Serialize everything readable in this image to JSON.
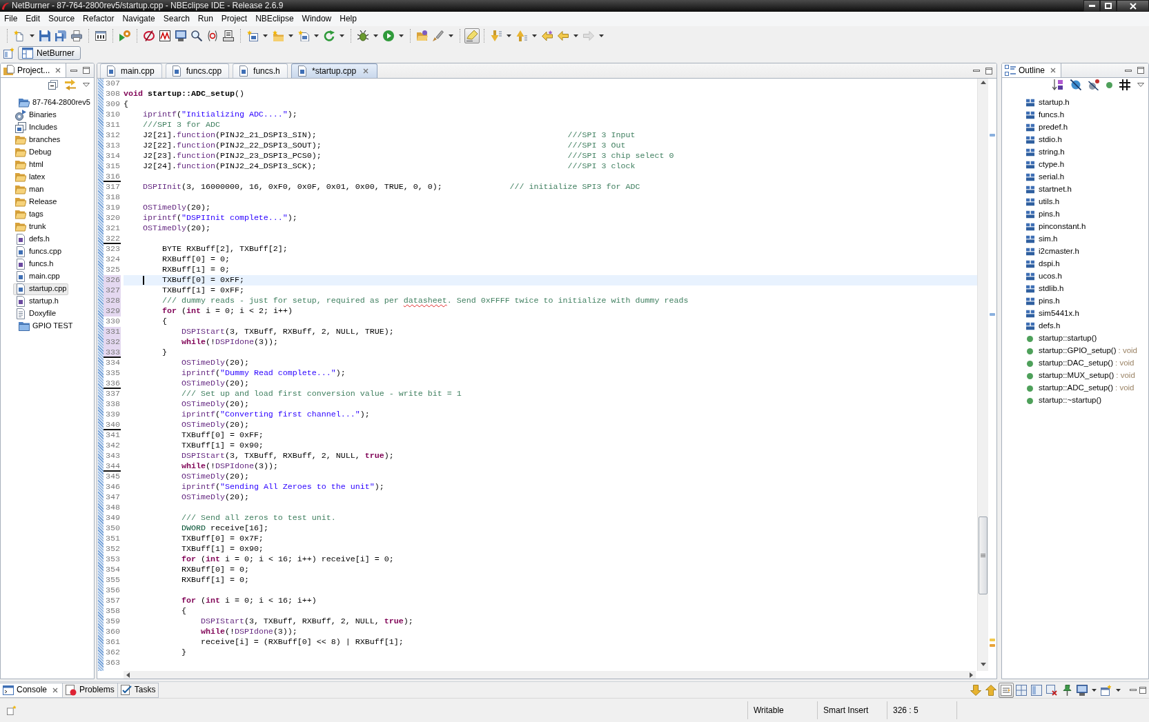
{
  "window": {
    "title": "NetBurner - 87-764-2800rev5/startup.cpp - NBEclipse IDE - Release 2.6.9"
  },
  "menu": [
    "File",
    "Edit",
    "Source",
    "Refactor",
    "Navigate",
    "Search",
    "Run",
    "Project",
    "NBEclipse",
    "Window",
    "Help"
  ],
  "toolbar": [
    {
      "items": [
        {
          "kind": "new",
          "dropdown": true,
          "pressed": false,
          "disabled": false
        },
        {
          "kind": "save",
          "dropdown": false,
          "pressed": false,
          "disabled": false
        },
        {
          "kind": "save_all",
          "dropdown": false,
          "pressed": false,
          "disabled": false
        },
        {
          "kind": "print",
          "dropdown": false,
          "pressed": false,
          "disabled": false
        }
      ]
    },
    {
      "items": [
        {
          "kind": "binary",
          "dropdown": false,
          "pressed": false,
          "disabled": false
        }
      ]
    },
    {
      "items": [
        {
          "kind": "run_gear",
          "dropdown": false,
          "pressed": false,
          "disabled": false
        }
      ]
    },
    {
      "items": [
        {
          "kind": "ring_slash",
          "dropdown": false,
          "pressed": false,
          "disabled": false
        },
        {
          "kind": "zigzag",
          "dropdown": false,
          "pressed": false,
          "disabled": false
        },
        {
          "kind": "monitor",
          "dropdown": false,
          "pressed": false,
          "disabled": false
        },
        {
          "kind": "search",
          "dropdown": false,
          "pressed": false,
          "disabled": false
        },
        {
          "kind": "circle",
          "dropdown": false,
          "pressed": false,
          "disabled": false
        },
        {
          "kind": "stack",
          "dropdown": false,
          "pressed": false,
          "disabled": false
        }
      ]
    },
    {
      "items": [
        {
          "kind": "new_class",
          "dropdown": true,
          "pressed": false,
          "disabled": false
        },
        {
          "kind": "new_folder",
          "dropdown": true,
          "pressed": false,
          "disabled": false
        },
        {
          "kind": "new_source",
          "dropdown": true,
          "pressed": false,
          "disabled": false
        },
        {
          "kind": "refresh_green",
          "dropdown": true,
          "pressed": false,
          "disabled": false
        }
      ]
    },
    {
      "items": [
        {
          "kind": "debug",
          "dropdown": true,
          "pressed": false,
          "disabled": false
        },
        {
          "kind": "run",
          "dropdown": true,
          "pressed": false,
          "disabled": false
        }
      ]
    },
    {
      "items": [
        {
          "kind": "open_folder",
          "dropdown": false,
          "pressed": false,
          "disabled": false
        },
        {
          "kind": "brush",
          "dropdown": true,
          "pressed": false,
          "disabled": false
        }
      ]
    },
    {
      "items": [
        {
          "kind": "highlight",
          "dropdown": false,
          "pressed": true,
          "disabled": false
        }
      ]
    },
    {
      "items": [
        {
          "kind": "next_annotation",
          "dropdown": true,
          "pressed": false,
          "disabled": false
        },
        {
          "kind": "prev_annotation",
          "dropdown": true,
          "pressed": false,
          "disabled": false
        },
        {
          "kind": "last_edit",
          "dropdown": false,
          "pressed": false,
          "disabled": false
        },
        {
          "kind": "back",
          "dropdown": true,
          "pressed": false,
          "disabled": false
        },
        {
          "kind": "forward",
          "dropdown": true,
          "pressed": false,
          "disabled": true
        }
      ]
    }
  ],
  "perspectives": [
    {
      "label": "NetBurner",
      "selected": true
    }
  ],
  "project_explorer": {
    "tab": {
      "label": "Project...",
      "selected": true
    },
    "items": [
      {
        "label": "87-764-2800rev5",
        "kind": "project",
        "expanded": true,
        "selected": false,
        "children": [
          {
            "label": "Binaries",
            "kind": "binaries",
            "selected": false
          },
          {
            "label": "Includes",
            "kind": "includes",
            "selected": false
          },
          {
            "label": "branches",
            "kind": "folder",
            "selected": false
          },
          {
            "label": "Debug",
            "kind": "folder",
            "selected": false
          },
          {
            "label": "html",
            "kind": "folder",
            "selected": false
          },
          {
            "label": "latex",
            "kind": "folder",
            "selected": false
          },
          {
            "label": "man",
            "kind": "folder",
            "selected": false
          },
          {
            "label": "Release",
            "kind": "folder",
            "selected": false
          },
          {
            "label": "tags",
            "kind": "folder",
            "selected": false
          },
          {
            "label": "trunk",
            "kind": "folder",
            "selected": false
          },
          {
            "label": "defs.h",
            "kind": "header",
            "selected": false
          },
          {
            "label": "funcs.cpp",
            "kind": "source",
            "selected": false
          },
          {
            "label": "funcs.h",
            "kind": "header",
            "selected": false
          },
          {
            "label": "main.cpp",
            "kind": "source",
            "selected": false
          },
          {
            "label": "startup.cpp",
            "kind": "source",
            "selected": true
          },
          {
            "label": "startup.h",
            "kind": "header",
            "selected": false
          },
          {
            "label": "Doxyfile",
            "kind": "text",
            "selected": false
          }
        ]
      },
      {
        "label": "GPIO TEST",
        "kind": "project",
        "expanded": false,
        "selected": false
      }
    ]
  },
  "editor": {
    "tabs": [
      {
        "label": "main.cpp",
        "selected": false
      },
      {
        "label": "funcs.cpp",
        "selected": false
      },
      {
        "label": "funcs.h",
        "selected": false
      },
      {
        "label": "*startup.cpp",
        "selected": true
      }
    ],
    "lines": [
      {
        "number": "307",
        "current": false,
        "changed": false,
        "deleted": false
      },
      {
        "number": "308",
        "current": false,
        "changed": false,
        "deleted": false,
        "tokens": [
          {
            "kind": "keyword",
            "text": "void"
          },
          {
            "kind": "declaration",
            "text": " startup::ADC_setup"
          },
          {
            "kind": "plain",
            "text": "()"
          }
        ]
      },
      {
        "number": "309",
        "current": false,
        "changed": false,
        "deleted": false,
        "tokens": [
          {
            "kind": "plain",
            "text": "{"
          }
        ]
      },
      {
        "number": "310",
        "current": false,
        "changed": false,
        "deleted": false,
        "tokens": [
          {
            "kind": "function",
            "text": "    iprintf"
          },
          {
            "kind": "plain",
            "text": "("
          },
          {
            "kind": "string",
            "text": "\"Initializing ADC....\""
          },
          {
            "kind": "plain",
            "text": ");"
          }
        ]
      },
      {
        "number": "311",
        "current": false,
        "changed": false,
        "deleted": false,
        "tokens": [
          {
            "kind": "comment",
            "text": "    ///SPI 3 for ADC"
          }
        ]
      },
      {
        "number": "312",
        "current": false,
        "changed": false,
        "deleted": false,
        "tokens": [
          {
            "kind": "plain",
            "text": "    J2[21]."
          },
          {
            "kind": "function",
            "text": "function"
          },
          {
            "kind": "plain",
            "text": "(PINJ2_21_DSPI3_SIN);                                                    "
          },
          {
            "kind": "comment",
            "text": "///SPI 3 Input"
          }
        ]
      },
      {
        "number": "313",
        "current": false,
        "changed": false,
        "deleted": false,
        "tokens": [
          {
            "kind": "plain",
            "text": "    J2[22]."
          },
          {
            "kind": "function",
            "text": "function"
          },
          {
            "kind": "plain",
            "text": "(PINJ2_22_DSPI3_SOUT);                                                   "
          },
          {
            "kind": "comment",
            "text": "///SPI 3 Out"
          }
        ]
      },
      {
        "number": "314",
        "current": false,
        "changed": false,
        "deleted": false,
        "tokens": [
          {
            "kind": "plain",
            "text": "    J2[23]."
          },
          {
            "kind": "function",
            "text": "function"
          },
          {
            "kind": "plain",
            "text": "(PINJ2_23_DSPI3_PCS0);                                                   "
          },
          {
            "kind": "comment",
            "text": "///SPI 3 chip select 0"
          }
        ]
      },
      {
        "number": "315",
        "current": false,
        "changed": false,
        "deleted": false,
        "tokens": [
          {
            "kind": "plain",
            "text": "    J2[24]."
          },
          {
            "kind": "function",
            "text": "function"
          },
          {
            "kind": "plain",
            "text": "(PINJ2_24_DSPI3_SCK);                                                    "
          },
          {
            "kind": "comment",
            "text": "///SPI 3 clock"
          }
        ]
      },
      {
        "number": "316",
        "current": false,
        "changed": false,
        "deleted": true
      },
      {
        "number": "317",
        "current": false,
        "changed": false,
        "deleted": false,
        "tokens": [
          {
            "kind": "function",
            "text": "    DSPIInit"
          },
          {
            "kind": "plain",
            "text": "(3, 16000000, 16, 0xF0, 0x0F, 0x01, 0x00, TRUE, 0, 0);              "
          },
          {
            "kind": "comment",
            "text": "/// initialize SPI3 for ADC"
          }
        ]
      },
      {
        "number": "318",
        "current": false,
        "changed": false,
        "deleted": false
      },
      {
        "number": "319",
        "current": false,
        "changed": false,
        "deleted": false,
        "tokens": [
          {
            "kind": "function",
            "text": "    OSTimeDly"
          },
          {
            "kind": "plain",
            "text": "(20);"
          }
        ]
      },
      {
        "number": "320",
        "current": false,
        "changed": false,
        "deleted": false,
        "tokens": [
          {
            "kind": "function",
            "text": "    iprintf"
          },
          {
            "kind": "plain",
            "text": "("
          },
          {
            "kind": "string",
            "text": "\"DSPIInit complete...\""
          },
          {
            "kind": "plain",
            "text": ");"
          }
        ]
      },
      {
        "number": "321",
        "current": false,
        "changed": false,
        "deleted": false,
        "tokens": [
          {
            "kind": "function",
            "text": "    OSTimeDly"
          },
          {
            "kind": "plain",
            "text": "(20);"
          }
        ]
      },
      {
        "number": "322",
        "current": false,
        "changed": false,
        "deleted": true
      },
      {
        "number": "323",
        "current": false,
        "changed": false,
        "deleted": false,
        "tokens": [
          {
            "kind": "plain",
            "text": "        BYTE RXBuff[2], TXBuff[2];"
          }
        ]
      },
      {
        "number": "324",
        "current": false,
        "changed": false,
        "deleted": false,
        "tokens": [
          {
            "kind": "plain",
            "text": "        RXBuff[0] = 0;"
          }
        ]
      },
      {
        "number": "325",
        "current": false,
        "changed": false,
        "deleted": false,
        "tokens": [
          {
            "kind": "plain",
            "text": "        RXBuff[1] = 0;"
          }
        ]
      },
      {
        "number": "326",
        "current": true,
        "changed": true,
        "deleted": false,
        "tokens": [
          {
            "kind": "plain",
            "text": "        TXBuff[0] = 0xFF;"
          }
        ]
      },
      {
        "number": "327",
        "current": false,
        "changed": true,
        "deleted": false,
        "tokens": [
          {
            "kind": "plain",
            "text": "        TXBuff[1] = 0xFF;"
          }
        ]
      },
      {
        "number": "328",
        "current": false,
        "changed": true,
        "deleted": false,
        "tokens": [
          {
            "kind": "comment",
            "text": "        /// dummy reads - just for setup, required as per "
          },
          {
            "kind": "misspelled",
            "text": "datasheet"
          },
          {
            "kind": "comment",
            "text": ". Send 0xFFFF twice to initialize with dummy reads"
          }
        ]
      },
      {
        "number": "329",
        "current": false,
        "changed": true,
        "deleted": false,
        "tokens": [
          {
            "kind": "keyword",
            "text": "        for"
          },
          {
            "kind": "plain",
            "text": " ("
          },
          {
            "kind": "keyword",
            "text": "int"
          },
          {
            "kind": "plain",
            "text": " i = 0; i < 2; i++)"
          }
        ]
      },
      {
        "number": "330",
        "current": false,
        "changed": false,
        "deleted": false,
        "tokens": [
          {
            "kind": "plain",
            "text": "        {"
          }
        ]
      },
      {
        "number": "331",
        "current": false,
        "changed": true,
        "deleted": false,
        "tokens": [
          {
            "kind": "function",
            "text": "            DSPIStart"
          },
          {
            "kind": "plain",
            "text": "(3, TXBuff, RXBuff, 2, NULL, TRUE);"
          }
        ]
      },
      {
        "number": "332",
        "current": false,
        "changed": true,
        "deleted": false,
        "tokens": [
          {
            "kind": "keyword",
            "text": "            while"
          },
          {
            "kind": "plain",
            "text": "(!"
          },
          {
            "kind": "function",
            "text": "DSPIdone"
          },
          {
            "kind": "plain",
            "text": "(3));"
          }
        ]
      },
      {
        "number": "333",
        "current": false,
        "changed": true,
        "deleted": true,
        "tokens": [
          {
            "kind": "plain",
            "text": "        }"
          }
        ]
      },
      {
        "number": "334",
        "current": false,
        "changed": false,
        "deleted": false,
        "tokens": [
          {
            "kind": "function",
            "text": "            OSTimeDly"
          },
          {
            "kind": "plain",
            "text": "(20);"
          }
        ]
      },
      {
        "number": "335",
        "current": false,
        "changed": false,
        "deleted": false,
        "tokens": [
          {
            "kind": "function",
            "text": "            iprintf"
          },
          {
            "kind": "plain",
            "text": "("
          },
          {
            "kind": "string",
            "text": "\"Dummy Read complete...\""
          },
          {
            "kind": "plain",
            "text": ");"
          }
        ]
      },
      {
        "number": "336",
        "current": false,
        "changed": false,
        "deleted": true,
        "tokens": [
          {
            "kind": "function",
            "text": "            OSTimeDly"
          },
          {
            "kind": "plain",
            "text": "(20);"
          }
        ]
      },
      {
        "number": "337",
        "current": false,
        "changed": false,
        "deleted": false,
        "tokens": [
          {
            "kind": "comment",
            "text": "            /// Set up and load first conversion value - write bit = 1"
          }
        ]
      },
      {
        "number": "338",
        "current": false,
        "changed": false,
        "deleted": false,
        "tokens": [
          {
            "kind": "function",
            "text": "            OSTimeDly"
          },
          {
            "kind": "plain",
            "text": "(20);"
          }
        ]
      },
      {
        "number": "339",
        "current": false,
        "changed": false,
        "deleted": false,
        "tokens": [
          {
            "kind": "function",
            "text": "            iprintf"
          },
          {
            "kind": "plain",
            "text": "("
          },
          {
            "kind": "string",
            "text": "\"Converting first channel...\""
          },
          {
            "kind": "plain",
            "text": ");"
          }
        ]
      },
      {
        "number": "340",
        "current": false,
        "changed": false,
        "deleted": true,
        "tokens": [
          {
            "kind": "function",
            "text": "            OSTimeDly"
          },
          {
            "kind": "plain",
            "text": "(20);"
          }
        ]
      },
      {
        "number": "341",
        "current": false,
        "changed": false,
        "deleted": false,
        "tokens": [
          {
            "kind": "plain",
            "text": "            TXBuff[0] = 0xFF;"
          }
        ]
      },
      {
        "number": "342",
        "current": false,
        "changed": false,
        "deleted": false,
        "tokens": [
          {
            "kind": "plain",
            "text": "            TXBuff[1] = 0x90;"
          }
        ]
      },
      {
        "number": "343",
        "current": false,
        "changed": false,
        "deleted": false,
        "tokens": [
          {
            "kind": "function",
            "text": "            DSPIStart"
          },
          {
            "kind": "plain",
            "text": "(3, TXBuff, RXBuff, 2, NULL, "
          },
          {
            "kind": "keyword",
            "text": "true"
          },
          {
            "kind": "plain",
            "text": ");"
          }
        ]
      },
      {
        "number": "344",
        "current": false,
        "changed": false,
        "deleted": true,
        "tokens": [
          {
            "kind": "keyword",
            "text": "            while"
          },
          {
            "kind": "plain",
            "text": "(!"
          },
          {
            "kind": "function",
            "text": "DSPIdone"
          },
          {
            "kind": "plain",
            "text": "(3));"
          }
        ]
      },
      {
        "number": "345",
        "current": false,
        "changed": false,
        "deleted": false,
        "tokens": [
          {
            "kind": "function",
            "text": "            OSTimeDly"
          },
          {
            "kind": "plain",
            "text": "(20);"
          }
        ]
      },
      {
        "number": "346",
        "current": false,
        "changed": false,
        "deleted": false,
        "tokens": [
          {
            "kind": "function",
            "text": "            iprintf"
          },
          {
            "kind": "plain",
            "text": "("
          },
          {
            "kind": "string",
            "text": "\"Sending All Zeroes to the unit\""
          },
          {
            "kind": "plain",
            "text": ");"
          }
        ]
      },
      {
        "number": "347",
        "current": false,
        "changed": false,
        "deleted": false,
        "tokens": [
          {
            "kind": "function",
            "text": "            OSTimeDly"
          },
          {
            "kind": "plain",
            "text": "(20);"
          }
        ]
      },
      {
        "number": "348",
        "current": false,
        "changed": false,
        "deleted": false
      },
      {
        "number": "349",
        "current": false,
        "changed": false,
        "deleted": false,
        "tokens": [
          {
            "kind": "comment",
            "text": "            /// Send all zeros to test unit."
          }
        ]
      },
      {
        "number": "350",
        "current": false,
        "changed": false,
        "deleted": false,
        "tokens": [
          {
            "kind": "type",
            "text": "            DWORD"
          },
          {
            "kind": "plain",
            "text": " receive[16];"
          }
        ]
      },
      {
        "number": "351",
        "current": false,
        "changed": false,
        "deleted": false,
        "tokens": [
          {
            "kind": "plain",
            "text": "            TXBuff[0] = 0x7F;"
          }
        ]
      },
      {
        "number": "352",
        "current": false,
        "changed": false,
        "deleted": false,
        "tokens": [
          {
            "kind": "plain",
            "text": "            TXBuff[1] = 0x90;"
          }
        ]
      },
      {
        "number": "353",
        "current": false,
        "changed": false,
        "deleted": false,
        "tokens": [
          {
            "kind": "keyword",
            "text": "            for"
          },
          {
            "kind": "plain",
            "text": " ("
          },
          {
            "kind": "keyword",
            "text": "int"
          },
          {
            "kind": "plain",
            "text": " i = 0; i < 16; i++) receive[i] = 0;"
          }
        ]
      },
      {
        "number": "354",
        "current": false,
        "changed": false,
        "deleted": false,
        "tokens": [
          {
            "kind": "plain",
            "text": "            RXBuff[0] = 0;"
          }
        ]
      },
      {
        "number": "355",
        "current": false,
        "changed": false,
        "deleted": false,
        "tokens": [
          {
            "kind": "plain",
            "text": "            RXBuff[1] = 0;"
          }
        ]
      },
      {
        "number": "356",
        "current": false,
        "changed": false,
        "deleted": false
      },
      {
        "number": "357",
        "current": false,
        "changed": false,
        "deleted": false,
        "tokens": [
          {
            "kind": "keyword",
            "text": "            for"
          },
          {
            "kind": "plain",
            "text": " ("
          },
          {
            "kind": "keyword",
            "text": "int"
          },
          {
            "kind": "plain",
            "text": " i = 0; i < 16; i++)"
          }
        ]
      },
      {
        "number": "358",
        "current": false,
        "changed": false,
        "deleted": false,
        "tokens": [
          {
            "kind": "plain",
            "text": "            {"
          }
        ]
      },
      {
        "number": "359",
        "current": false,
        "changed": false,
        "deleted": false,
        "tokens": [
          {
            "kind": "function",
            "text": "                DSPIStart"
          },
          {
            "kind": "plain",
            "text": "(3, TXBuff, RXBuff, 2, NULL, "
          },
          {
            "kind": "keyword",
            "text": "true"
          },
          {
            "kind": "plain",
            "text": ");"
          }
        ]
      },
      {
        "number": "360",
        "current": false,
        "changed": false,
        "deleted": false,
        "tokens": [
          {
            "kind": "keyword",
            "text": "                while"
          },
          {
            "kind": "plain",
            "text": "(!"
          },
          {
            "kind": "function",
            "text": "DSPIdone"
          },
          {
            "kind": "plain",
            "text": "(3));"
          }
        ]
      },
      {
        "number": "361",
        "current": false,
        "changed": false,
        "deleted": false,
        "tokens": [
          {
            "kind": "plain",
            "text": "                receive[i] = (RXBuff[0] << 8) | RXBuff[1];"
          }
        ]
      },
      {
        "number": "362",
        "current": false,
        "changed": false,
        "deleted": false,
        "tokens": [
          {
            "kind": "plain",
            "text": "            }"
          }
        ]
      },
      {
        "number": "363",
        "current": false,
        "changed": false,
        "deleted": false
      }
    ]
  },
  "outline": {
    "tab": {
      "label": "Outline",
      "selected": true
    },
    "items": [
      {
        "kind": "include",
        "label": "startup.h",
        "selected": false
      },
      {
        "kind": "include",
        "label": "funcs.h",
        "selected": false
      },
      {
        "kind": "include",
        "label": "predef.h",
        "selected": false
      },
      {
        "kind": "include",
        "label": "stdio.h",
        "selected": false
      },
      {
        "kind": "include",
        "label": "string.h",
        "selected": false
      },
      {
        "kind": "include",
        "label": "ctype.h",
        "selected": false
      },
      {
        "kind": "include",
        "label": "serial.h",
        "selected": false
      },
      {
        "kind": "include",
        "label": "startnet.h",
        "selected": false
      },
      {
        "kind": "include",
        "label": "utils.h",
        "selected": false
      },
      {
        "kind": "include",
        "label": "pins.h",
        "selected": false
      },
      {
        "kind": "include",
        "label": "pinconstant.h",
        "selected": false
      },
      {
        "kind": "include",
        "label": "sim.h",
        "selected": false
      },
      {
        "kind": "include",
        "label": "i2cmaster.h",
        "selected": false
      },
      {
        "kind": "include",
        "label": "dspi.h",
        "selected": false
      },
      {
        "kind": "include",
        "label": "ucos.h",
        "selected": false
      },
      {
        "kind": "include",
        "label": "stdlib.h",
        "selected": false
      },
      {
        "kind": "include",
        "label": "pins.h",
        "selected": false
      },
      {
        "kind": "include",
        "label": "sim5441x.h",
        "selected": false
      },
      {
        "kind": "include",
        "label": "defs.h",
        "selected": false
      },
      {
        "kind": "method",
        "label": "startup::startup()",
        "selected": false
      },
      {
        "kind": "method",
        "label": "startup::GPIO_setup()",
        "return_type": ": void",
        "selected": false
      },
      {
        "kind": "method",
        "label": "startup::DAC_setup()",
        "return_type": ": void",
        "selected": false
      },
      {
        "kind": "method",
        "label": "startup::MUX_setup()",
        "return_type": ": void",
        "selected": false
      },
      {
        "kind": "method",
        "label": "startup::ADC_setup()",
        "return_type": ": void",
        "selected": false
      },
      {
        "kind": "method",
        "label": "startup::~startup()",
        "selected": false
      }
    ]
  },
  "console": {
    "tabs": [
      {
        "label": "Console",
        "selected": true
      },
      {
        "label": "Problems",
        "selected": false
      },
      {
        "label": "Tasks",
        "selected": false
      }
    ],
    "toolbar": [
      {
        "kind": "down_yellow",
        "dropdown": false,
        "pressed": false
      },
      {
        "kind": "up_yellow",
        "dropdown": false,
        "pressed": false
      },
      {
        "kind": "wrap",
        "dropdown": false,
        "pressed": true
      },
      {
        "kind": "win_grid",
        "dropdown": false,
        "pressed": false
      },
      {
        "kind": "win_split",
        "dropdown": false,
        "pressed": false
      },
      {
        "kind": "win_remove",
        "dropdown": false,
        "pressed": false
      },
      {
        "kind": "pin",
        "dropdown": false,
        "pressed": false
      },
      {
        "kind": "monitor",
        "dropdown": true,
        "pressed": false
      },
      {
        "kind": "window_new",
        "dropdown": true,
        "pressed": false
      }
    ]
  },
  "status_bar": {
    "fields": [
      "Writable",
      "Smart Insert",
      "326 : 5"
    ]
  }
}
